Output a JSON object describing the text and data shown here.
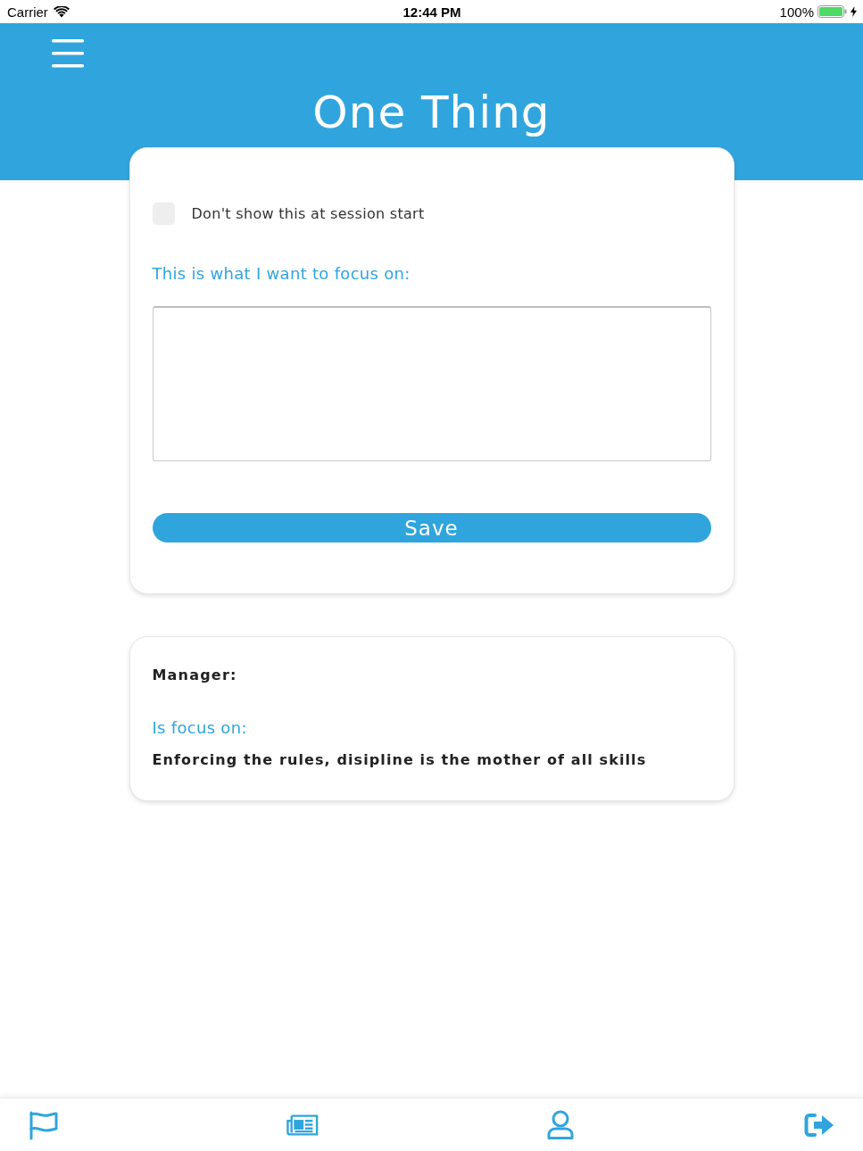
{
  "status_bar": {
    "carrier": "Carrier",
    "time": "12:44 PM",
    "battery": "100%"
  },
  "header": {
    "title": "One Thing"
  },
  "focus_card": {
    "dont_show": {
      "label": "Don't show this at session start",
      "checked": false
    },
    "prompt": "This is what I want to focus on:",
    "save_button": "Save"
  },
  "manager_card": {
    "heading": "Manager:",
    "focus_label": "Is focus on:",
    "focus_text": "Enforcing the rules, disipline is the mother of all skills"
  }
}
